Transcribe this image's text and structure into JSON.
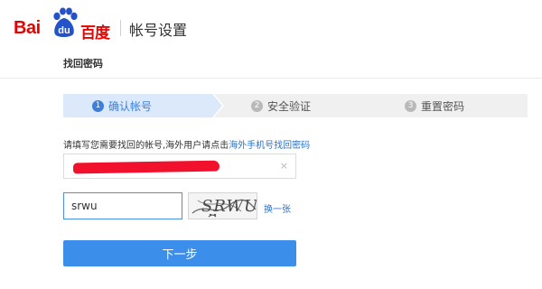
{
  "header": {
    "logo_text_latin_a": "Bai",
    "logo_text_paw": "du",
    "logo_text_cn": "百度",
    "title": "帐号设置"
  },
  "subheader": {
    "title": "找回密码"
  },
  "steps": [
    {
      "number": "1",
      "label": "确认帐号",
      "state": "active"
    },
    {
      "number": "2",
      "label": "安全验证",
      "state": "inactive"
    },
    {
      "number": "3",
      "label": "重置密码",
      "state": "inactive"
    }
  ],
  "instruction": {
    "text": "请填写您需要找回的帐号,海外用户请点击",
    "link": "海外手机号找回密码"
  },
  "account_field": {
    "value_redacted": true,
    "clear_icon": "×"
  },
  "captcha": {
    "input_value": "srwu",
    "image_text": "SRWU",
    "refresh_label": "换一张"
  },
  "next_button": {
    "label": "下一步"
  },
  "colors": {
    "brand_red": "#e10601",
    "accent_blue": "#3d7fd8",
    "button_blue": "#3b8eea",
    "link_blue": "#2c72c7",
    "active_step_bg": "#dbe9fb"
  }
}
